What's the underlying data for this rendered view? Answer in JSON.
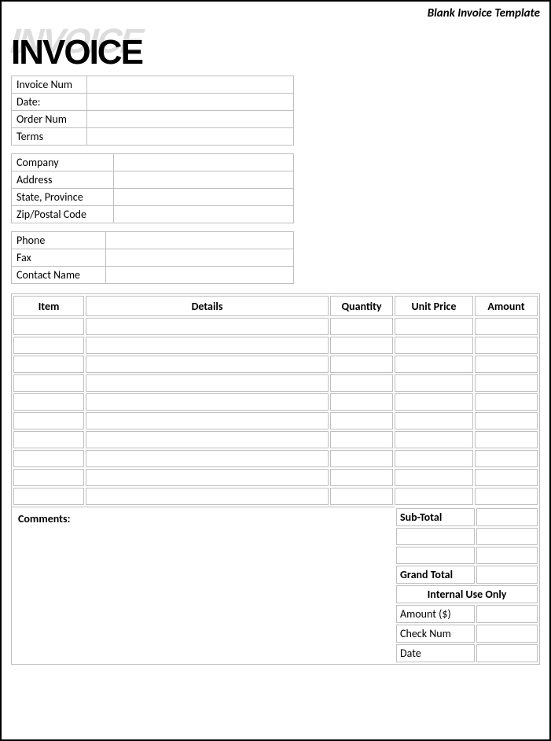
{
  "header": {
    "templateLabel": "Blank Invoice Template"
  },
  "logo": {
    "text": "INVOICE"
  },
  "invoiceInfo": {
    "invoiceNumLabel": "Invoice Num",
    "invoiceNum": "",
    "dateLabel": "Date:",
    "date": "",
    "orderNumLabel": "Order Num",
    "orderNum": "",
    "termsLabel": "Terms",
    "terms": ""
  },
  "companyInfo": {
    "companyLabel": "Company",
    "company": "",
    "addressLabel": "Address",
    "address": "",
    "stateLabel": "State, Province",
    "state": "",
    "zipLabel": "Zip/Postal Code",
    "zip": ""
  },
  "contactInfo": {
    "phoneLabel": "Phone",
    "phone": "",
    "faxLabel": "Fax",
    "fax": "",
    "contactNameLabel": "Contact Name",
    "contactName": ""
  },
  "itemsTable": {
    "headers": {
      "item": "Item",
      "details": "Details",
      "quantity": "Quantity",
      "unitPrice": "Unit Price",
      "amount": "Amount"
    },
    "rows": [
      {
        "item": "",
        "details": "",
        "quantity": "",
        "unitPrice": "",
        "amount": ""
      },
      {
        "item": "",
        "details": "",
        "quantity": "",
        "unitPrice": "",
        "amount": ""
      },
      {
        "item": "",
        "details": "",
        "quantity": "",
        "unitPrice": "",
        "amount": ""
      },
      {
        "item": "",
        "details": "",
        "quantity": "",
        "unitPrice": "",
        "amount": ""
      },
      {
        "item": "",
        "details": "",
        "quantity": "",
        "unitPrice": "",
        "amount": ""
      },
      {
        "item": "",
        "details": "",
        "quantity": "",
        "unitPrice": "",
        "amount": ""
      },
      {
        "item": "",
        "details": "",
        "quantity": "",
        "unitPrice": "",
        "amount": ""
      },
      {
        "item": "",
        "details": "",
        "quantity": "",
        "unitPrice": "",
        "amount": ""
      },
      {
        "item": "",
        "details": "",
        "quantity": "",
        "unitPrice": "",
        "amount": ""
      },
      {
        "item": "",
        "details": "",
        "quantity": "",
        "unitPrice": "",
        "amount": ""
      }
    ]
  },
  "comments": {
    "label": "Comments:",
    "value": ""
  },
  "totals": {
    "subTotalLabel": "Sub-Total",
    "subTotal": "",
    "blank1a": "",
    "blank1b": "",
    "blank2a": "",
    "blank2b": "",
    "grandTotalLabel": "Grand Total",
    "grandTotal": "",
    "internalLabel": "Internal Use Only",
    "amountLabel": "Amount ($)",
    "amount": "",
    "checkNumLabel": "Check Num",
    "checkNum": "",
    "dateLabel": "Date",
    "date": ""
  }
}
